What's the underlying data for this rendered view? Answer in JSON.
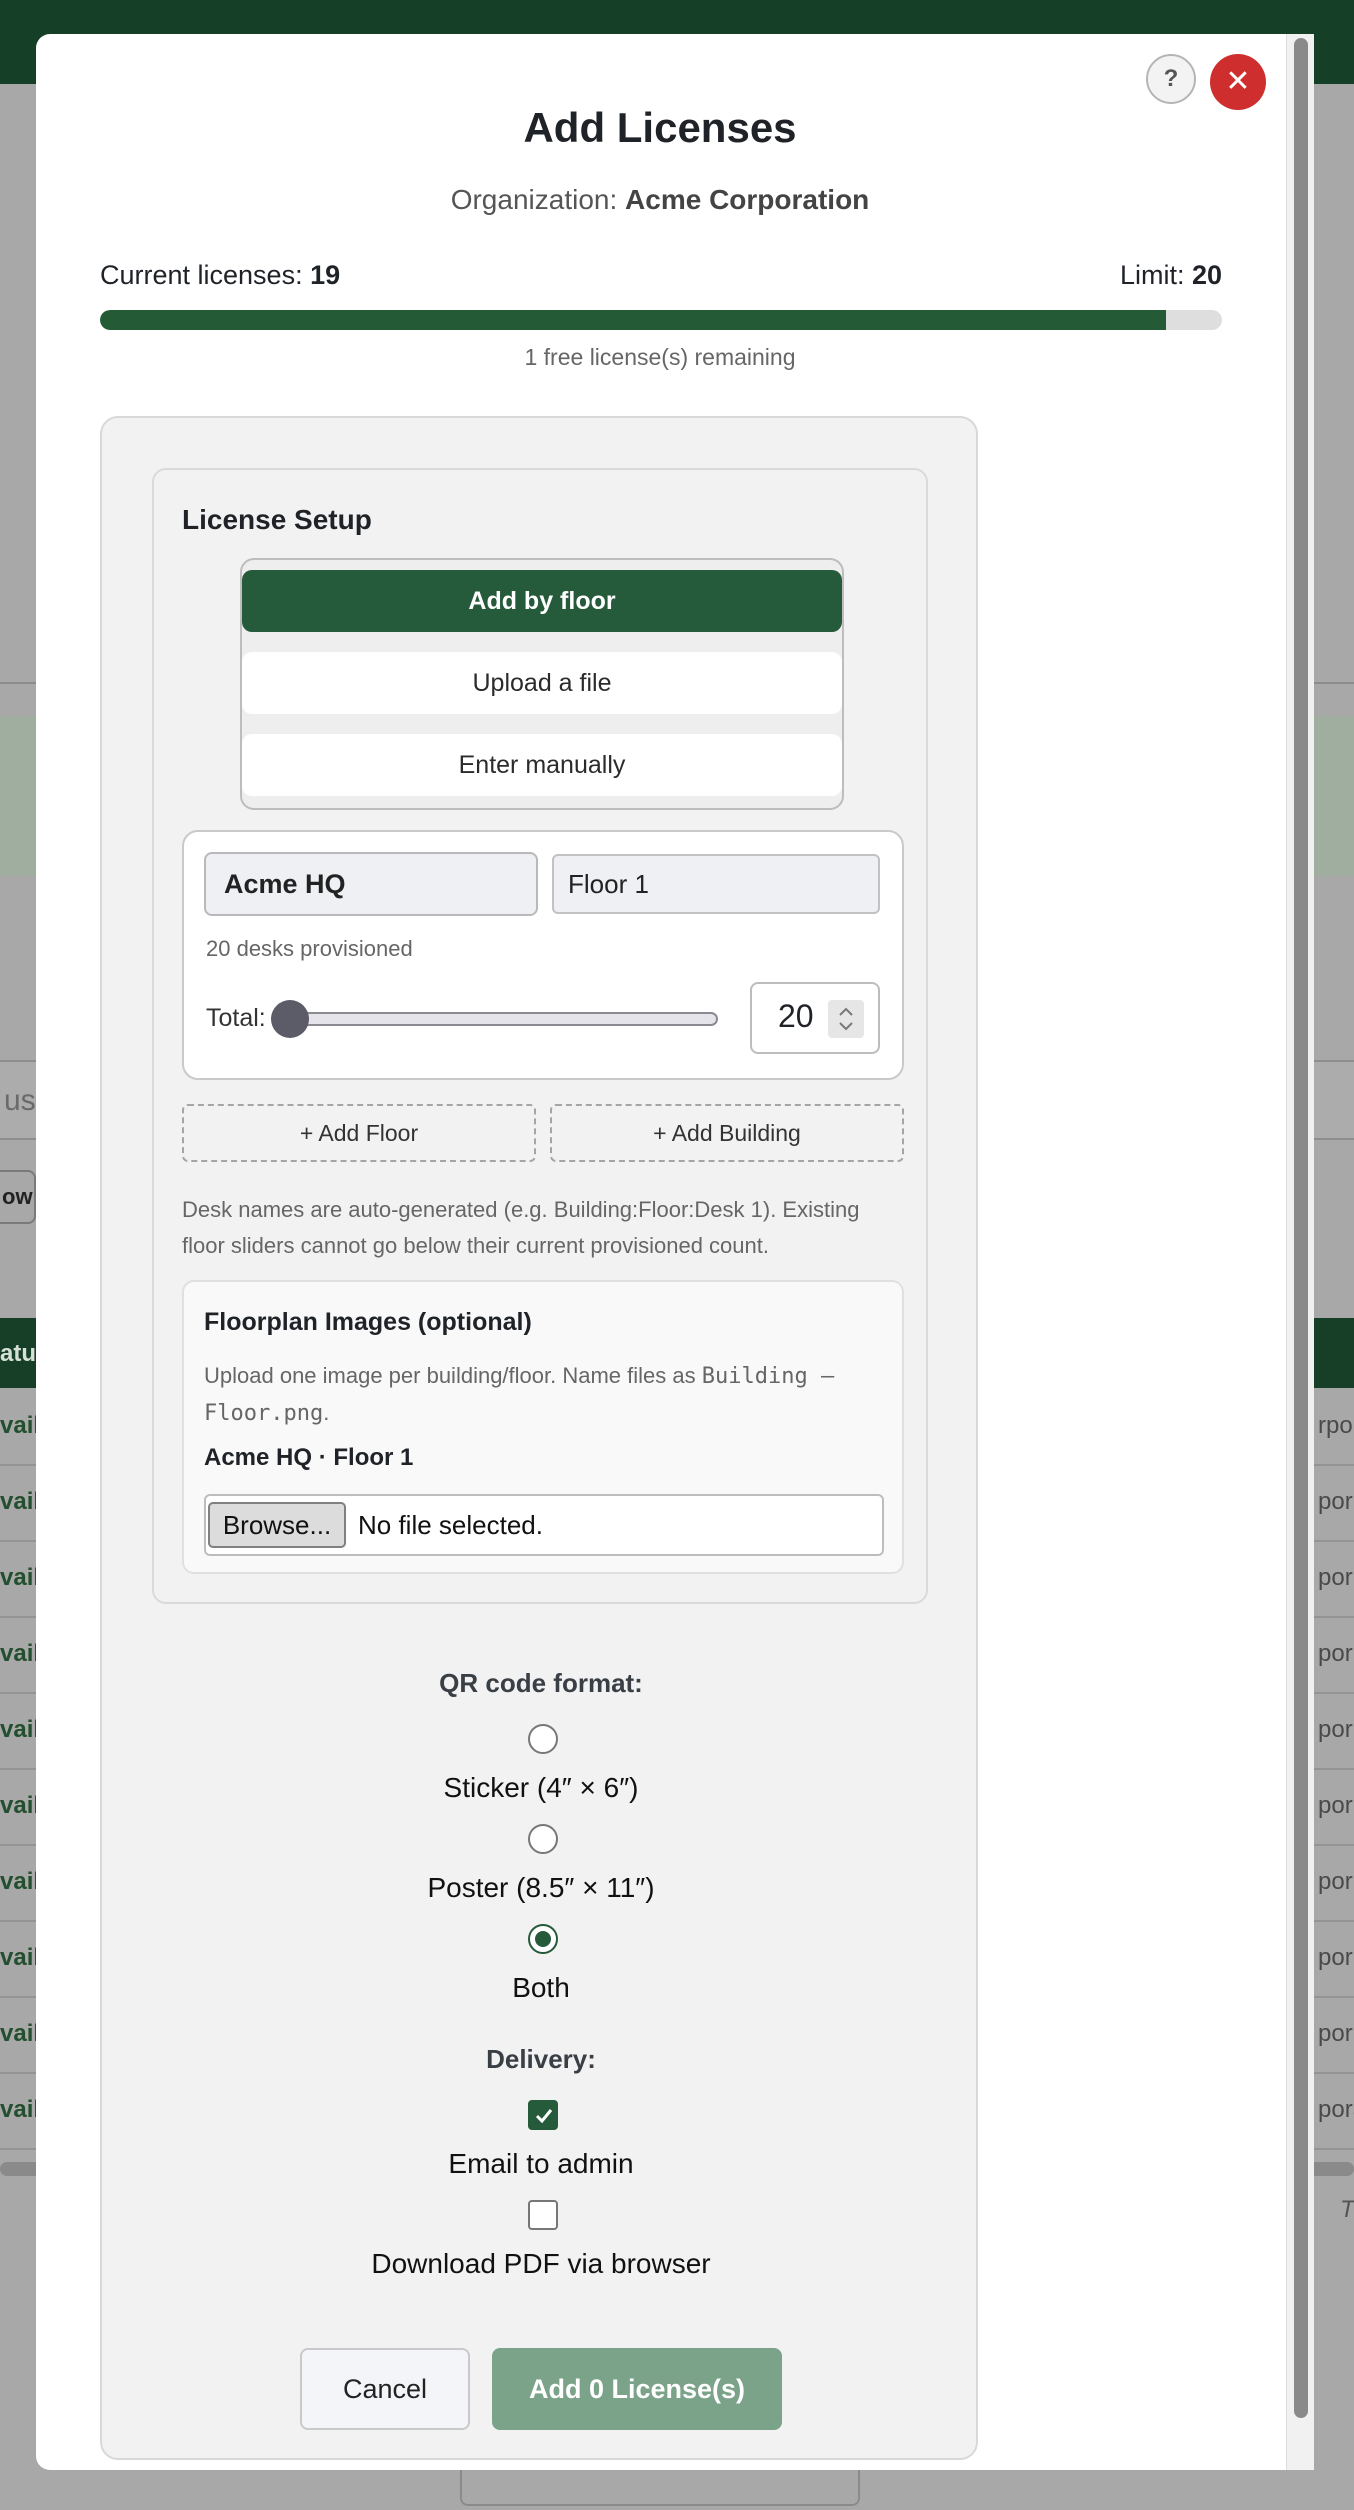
{
  "background": {
    "search_fragment": "us",
    "row_button_fragment": "ow",
    "table_header_fragment": "atu",
    "row_left_fragment": "vaila",
    "row_right_fragments": [
      "rpor",
      "por",
      "por",
      "por",
      "por",
      "por",
      "por",
      "por",
      "por",
      "pora"
    ],
    "footer_fragment": "T"
  },
  "modal": {
    "help_label": "?",
    "close_label": "✕",
    "title": "Add Licenses",
    "org_prefix": "Organization: ",
    "org_name": "Acme Corporation",
    "current_prefix": "Current licenses: ",
    "current_value": "19",
    "limit_prefix": "Limit: ",
    "limit_value": "20",
    "usage_fraction": 0.95,
    "remaining_text": "1 free license(s) remaining"
  },
  "setup": {
    "title": "License Setup",
    "modes": [
      {
        "label": "Add by floor",
        "active": true
      },
      {
        "label": "Upload a file",
        "active": false
      },
      {
        "label": "Enter manually",
        "active": false
      }
    ],
    "building_value": "Acme HQ",
    "floor_value": "Floor 1",
    "desks_note": "20 desks provisioned",
    "total_label": "Total:",
    "total_value": "20",
    "slider_fraction": 0.0,
    "add_floor_label": "+ Add Floor",
    "add_building_label": "+ Add Building",
    "desk_note": "Desk names are auto-generated (e.g. Building:Floor:Desk 1). Existing floor sliders cannot go below their current provisioned count."
  },
  "floorplan": {
    "title": "Floorplan Images (optional)",
    "desc_prefix": "Upload one image per building/floor. Name files as ",
    "desc_code": "Building – Floor.png",
    "desc_suffix": ".",
    "item_label": "Acme HQ · Floor 1",
    "browse_label": "Browse...",
    "file_status": "No file selected."
  },
  "qr": {
    "label": "QR code format:",
    "options": [
      {
        "label": "Sticker (4″ × 6″)",
        "checked": false
      },
      {
        "label": "Poster (8.5″ × 11″)",
        "checked": false
      },
      {
        "label": "Both",
        "checked": true
      }
    ]
  },
  "delivery": {
    "label": "Delivery:",
    "options": [
      {
        "label": "Email to admin",
        "checked": true
      },
      {
        "label": "Download PDF via browser",
        "checked": false
      }
    ]
  },
  "actions": {
    "cancel_label": "Cancel",
    "add_label": "Add 0 License(s)"
  },
  "colors": {
    "brand_green": "#255a3a",
    "close_red": "#cf2e2e",
    "add_button_disabled": "#7aa38a"
  }
}
